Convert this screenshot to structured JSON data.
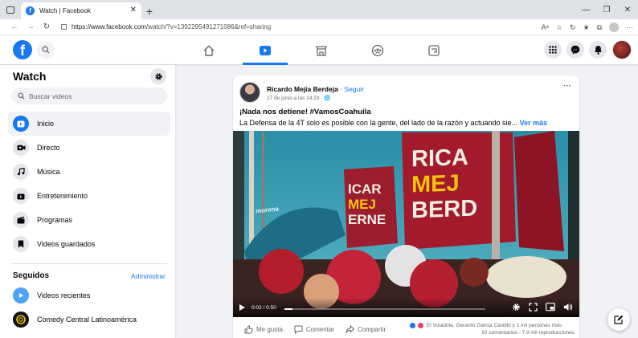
{
  "browser": {
    "tab_title": "Watch | Facebook",
    "tab_favicon": "f",
    "url_domain": "https://www.facebook.com",
    "url_path": "/watch/?v=1392295491271086&ref=sharing"
  },
  "fb": {
    "logo_letter": "f",
    "accent": "#1877f2"
  },
  "sidebar": {
    "title": "Watch",
    "search_placeholder": "Buscar videos",
    "items": [
      {
        "label": "Inicio",
        "icon": "watch-play-icon",
        "active": true
      },
      {
        "label": "Directo",
        "icon": "live-camera-icon"
      },
      {
        "label": "Música",
        "icon": "music-note-icon"
      },
      {
        "label": "Entretenimiento",
        "icon": "entertainment-icon"
      },
      {
        "label": "Programas",
        "icon": "clapperboard-icon"
      },
      {
        "label": "Videos guardados",
        "icon": "bookmark-icon"
      }
    ],
    "section_title": "Seguidos",
    "section_action": "Administrar",
    "followed": [
      {
        "label": "Videos recientes",
        "icon": "play-circle-icon"
      },
      {
        "label": "Comedy Central Latinoamérica",
        "icon": "comedy-central-logo"
      }
    ]
  },
  "post": {
    "author": "Ricardo Mejía Berdeja",
    "separator": "·",
    "follow": "Seguir",
    "date": "27 de junio a las 14:23 · ",
    "title": "¡Nada nos detiene! #VamosCoahuila",
    "description": "La Defensa de la 4T solo es posible con la gente, del lado de la razón y actuando sie... ",
    "see_more": "Ver más",
    "banner_top": [
      "RICA",
      "MEJ",
      "BERD"
    ],
    "banner_left": [
      "ICAR",
      "MEJ",
      "ERNE"
    ],
    "morena": "morena",
    "video_time": "0:02 / 0:50",
    "video_progress": 0.04,
    "like": "Me gusta",
    "comment": "Comentar",
    "share": "Compartir",
    "reactions_text": "El Voladote, Gerardo García Castillo y 1 mil personas más ·",
    "stats_text": "92 comentarios · 7.9 mil reproducciones"
  }
}
